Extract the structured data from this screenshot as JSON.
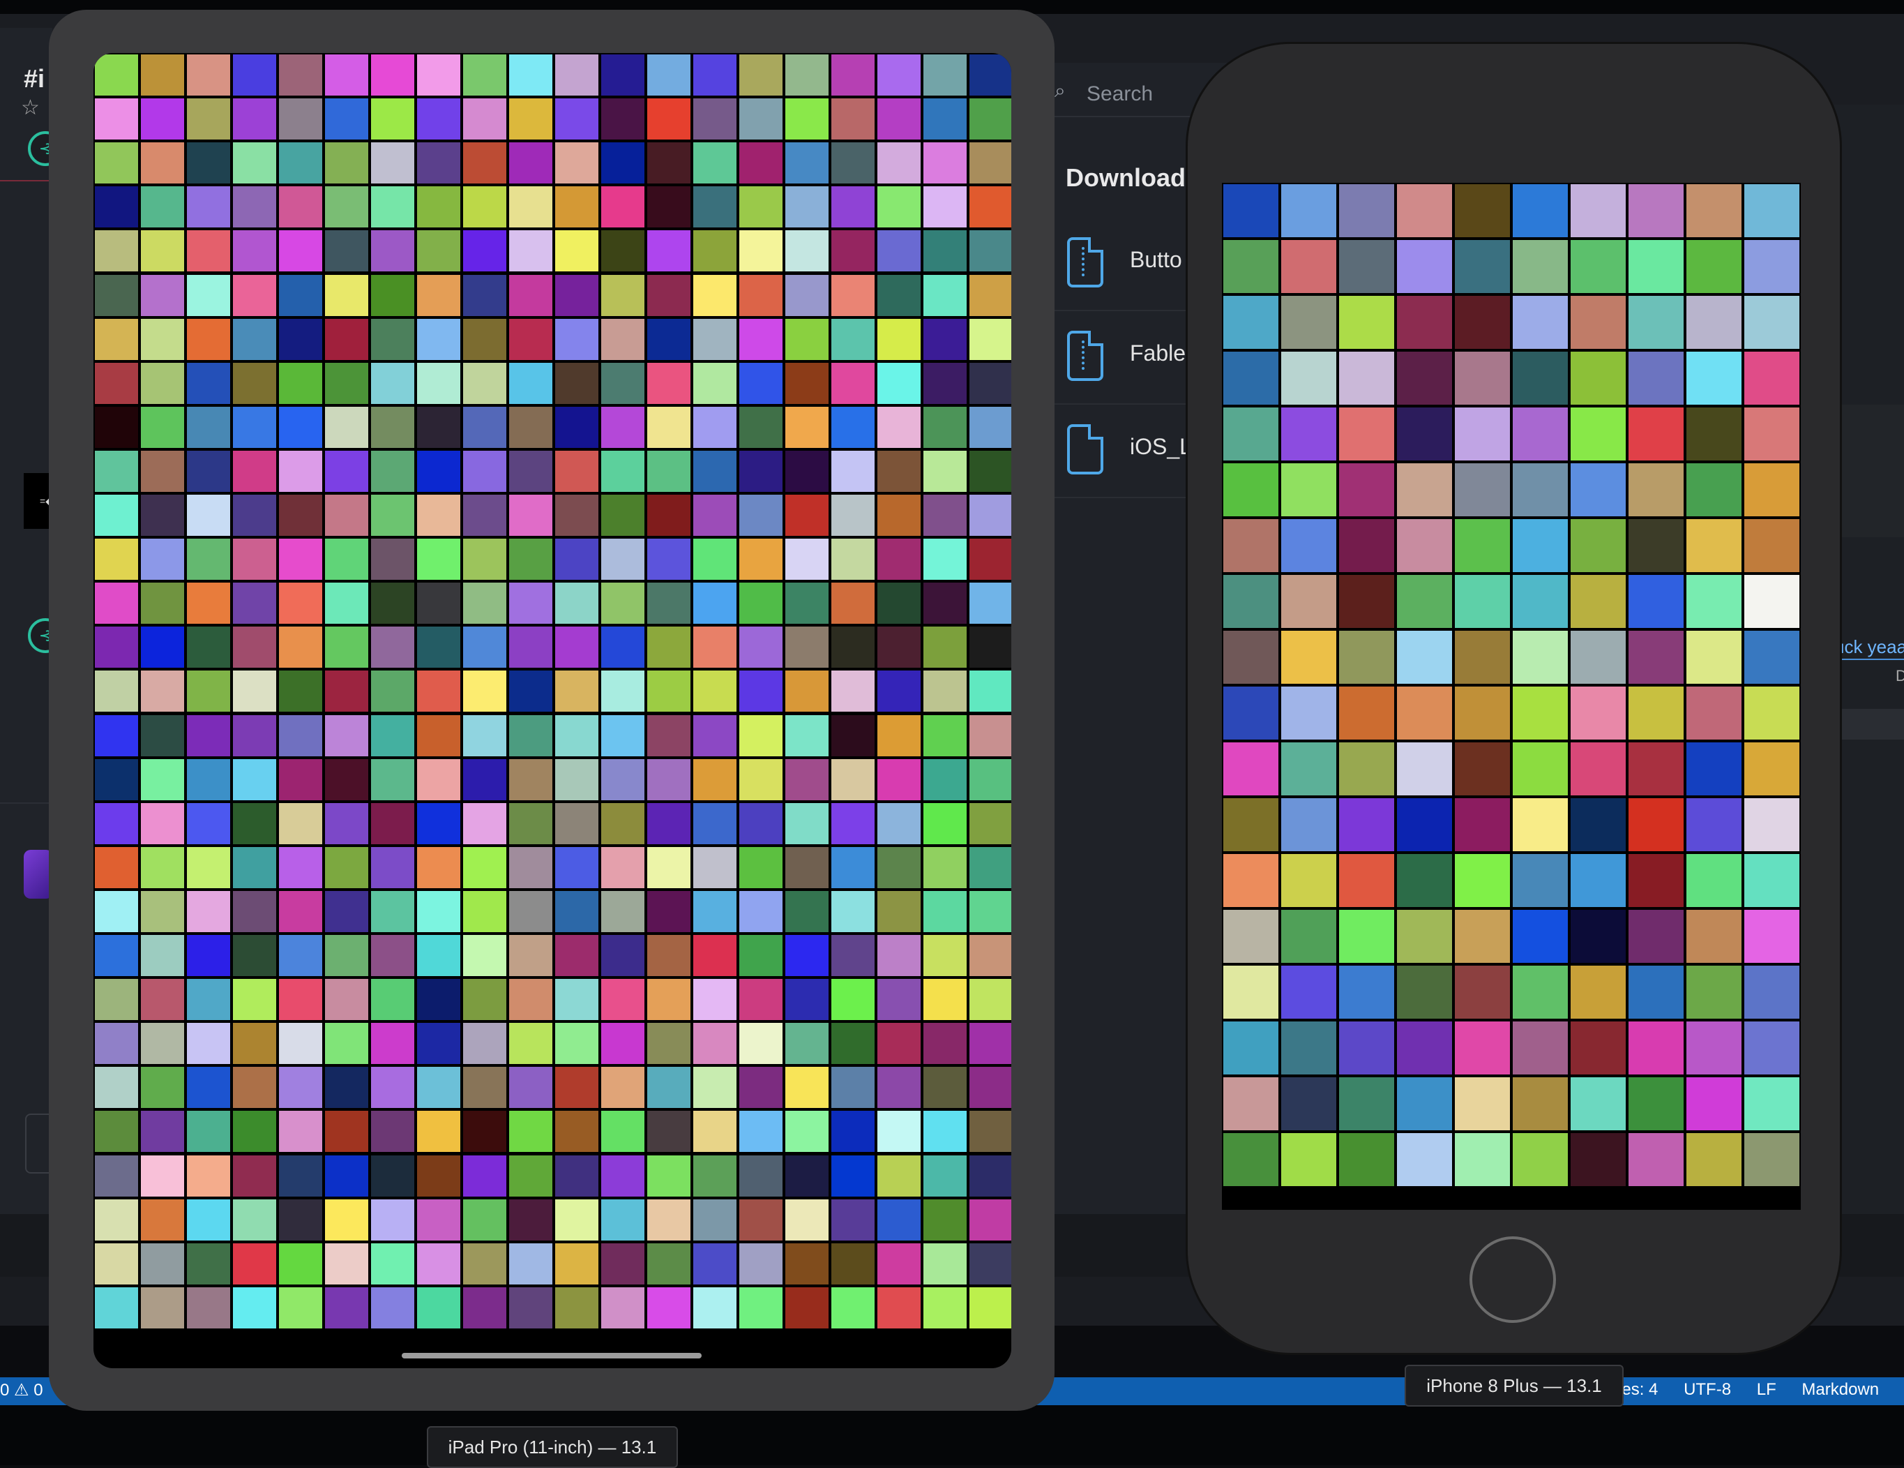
{
  "app": {
    "channel_title": "#i",
    "search_placeholder": "Search",
    "downloads_title": "Downloads",
    "files": [
      {
        "name": "Butto",
        "icon": "zip-file-icon"
      },
      {
        "name": "Fable",
        "icon": "zip-file-icon"
      },
      {
        "name": "iOS_L",
        "icon": "document-icon"
      }
    ],
    "right_partial_text": "uck yeaa",
    "right_partial_text_2": "D"
  },
  "status_bar": {
    "left": "0 ⚠ 0",
    "spaces": "aces: 4",
    "encoding": "UTF-8",
    "eol": "LF",
    "language": "Markdown"
  },
  "simulators": {
    "ipad": {
      "label": "iPad Pro (11-inch) — 13.1",
      "cols": 20,
      "rows": 29,
      "colors": [
        "#8ad84f",
        "#bc9238",
        "#d89384",
        "#4a3ee0",
        "#9c6478",
        "#d45de6",
        "#e64ad6",
        "#f29be9",
        "#7ac86c",
        "#7ee9f5",
        "#c4a4d0",
        "#251c93",
        "#73ace0",
        "#5543e0",
        "#a9a85d",
        "#93b88d",
        "#b640b3",
        "#a96aee",
        "#73a4a8",
        "#163289",
        "#ec8fe6",
        "#b239e9",
        "#a7a65c",
        "#9c41d6",
        "#8c808d",
        "#3069d9",
        "#9ce847",
        "#7141e9",
        "#d58ad0",
        "#dcb83c",
        "#7a4ae8",
        "#4a1446",
        "#e6402e",
        "#765a8a",
        "#81a1ae",
        "#8ae84a",
        "#b86868",
        "#b43ec4",
        "#3076bb",
        "#50a04a",
        "#91c65a",
        "#d88a6c",
        "#1f4250",
        "#8ae0a4",
        "#48a4a1",
        "#84b054",
        "#c0bfd0",
        "#5b408c",
        "#bc4c34",
        "#9f2ab8",
        "#dea89a",
        "#06209a",
        "#481c24",
        "#5ec896",
        "#a0226e",
        "#4789c4",
        "#4a6368",
        "#d3abdd",
        "#db7ddf",
        "#a88d5c",
        "#111680",
        "#56b78d",
        "#9170e0",
        "#8d67b4",
        "#d05896",
        "#7abd74",
        "#76e5a8",
        "#86b840",
        "#bcd848",
        "#e7e090",
        "#d49935",
        "#e63a8c",
        "#380c1c",
        "#3a707c",
        "#9ac94a",
        "#8ab0d8",
        "#8f43d5",
        "#88e870",
        "#dcb6f4",
        "#e05a2e",
        "#b8bc7e",
        "#ccda62",
        "#e4606c",
        "#b156d0",
        "#d748e4",
        "#3f5660",
        "#9c59c6",
        "#82b04a",
        "#6624e8",
        "#d8c0ee",
        "#f0f060",
        "#3c4416",
        "#ae45ee",
        "#8ca43a",
        "#f4f49a",
        "#c4e6e1",
        "#952560",
        "#6a6ad2",
        "#338078",
        "#4a888a",
        "#4a6650",
        "#b471cc",
        "#9bf4e0",
        "#ea6498",
        "#2460ac",
        "#e8e86a",
        "#4a9024",
        "#e49e56",
        "#333c8c",
        "#c43a9e",
        "#76229c",
        "#b8c058",
        "#8c2a50",
        "#fce86c",
        "#dc6448",
        "#9898cc",
        "#ea8474",
        "#2e6a5c",
        "#6ae6c4",
        "#cea046",
        "#d4b454",
        "#c4dc8c",
        "#e46c34",
        "#4a8cb8",
        "#141c80",
        "#a0203c",
        "#4c805c",
        "#80b8f0",
        "#7c6c30",
        "#b82c50",
        "#8484ec",
        "#c89c94",
        "#0c2a94",
        "#a0b4c0",
        "#ce4ae8",
        "#8ad040",
        "#5cc4ac",
        "#d6ec4a",
        "#3b1c96",
        "#d6f48c",
        "#a83c44",
        "#a6c474",
        "#2450b8",
        "#7c7030",
        "#5ab838",
        "#4c9438",
        "#82d0d8",
        "#b0ecd4",
        "#c0d49c",
        "#58c4e8",
        "#503a2c",
        "#4c7c70",
        "#ea5480",
        "#b0e8a0",
        "#3054e8",
        "#8c3c18",
        "#e0489e",
        "#6af4e8",
        "#3c1c64",
        "#30304c",
        "#200408",
        "#5ec45c",
        "#4888b4",
        "#3878e4",
        "#2864f0",
        "#ccd8bc",
        "#748c60",
        "#2c2434",
        "#5468b8",
        "#846c54",
        "#141490",
        "#b448d8",
        "#f0e490",
        "#a09cf0",
        "#407048",
        "#f0a84c",
        "#2870e8",
        "#e8b4d8",
        "#4c9458",
        "#6c9cd0",
        "#60c49c",
        "#9c6c58",
        "#2c3888",
        "#d03c88",
        "#dc9ce8",
        "#7c40e4",
        "#5ca874",
        "#0c28d0",
        "#8868e0",
        "#5c4480",
        "#d05854",
        "#5cd09c",
        "#5cc084",
        "#2c68b0",
        "#2c1c84",
        "#2c0c44",
        "#c4c4f4",
        "#7c5438",
        "#b8e898",
        "#2c5424",
        "#6ef0d0",
        "#3e3050",
        "#c8dcf4",
        "#4c3c8c",
        "#703038",
        "#c47888",
        "#6cc470",
        "#e8b898",
        "#6c4c8c",
        "#e06cc8",
        "#7c4c50",
        "#4c802c",
        "#801c1c",
        "#9c4cb8",
        "#6c88c4",
        "#c03028",
        "#b8c4c8",
        "#b8682c",
        "#80508c",
        "#a09ce0",
        "#e0d450",
        "#8c98e8",
        "#64b870",
        "#cc6090",
        "#e64ccc",
        "#60d478",
        "#6c5468",
        "#70f06c",
        "#9cc45c",
        "#58a044",
        "#4c44c4",
        "#acbcdc",
        "#5c54dc",
        "#60e478",
        "#e8a440",
        "#d8d4f4",
        "#c4d8a0",
        "#a02c70",
        "#74f4d8",
        "#9c2430",
        "#e04cc8",
        "#709440",
        "#e87c3c",
        "#7044a8",
        "#f06c58",
        "#6ce8b8",
        "#2c4424",
        "#38383c",
        "#90bc84",
        "#a070e0",
        "#8cd4c8",
        "#90c468",
        "#4c7868",
        "#4ca4f0",
        "#50bc48",
        "#3c8464",
        "#d06c3c",
        "#244830",
        "#3c1438",
        "#70b4e8",
        "#7c28b0",
        "#0c24dc",
        "#2c5c3c",
        "#a04c6c",
        "#e8904c",
        "#64c860",
        "#90689c",
        "#245c64",
        "#5088d8",
        "#8c40c4",
        "#a43cd0",
        "#2448d8",
        "#8ca83c",
        "#e88068",
        "#9c68d8",
        "#8c7c6c",
        "#2c2c20",
        "#4c2030",
        "#7ca03c",
        "#1c1c1c",
        "#c0d0a4",
        "#d8aaa4",
        "#80b448",
        "#dce0c4",
        "#3c7028",
        "#9c2440",
        "#5ca868",
        "#e05c4c",
        "#fcec70",
        "#0c2c8c",
        "#d8b460",
        "#a8ece0",
        "#9ccc44",
        "#c8dc50",
        "#5c38e4",
        "#d89838",
        "#e0bcd8",
        "#3424b8",
        "#bcc490",
        "#60e8c0",
        "#3034f0",
        "#2c4c44",
        "#7c2cb8",
        "#7c3cb4",
        "#7070c0",
        "#bc84d8",
        "#44b0a0",
        "#c8602c",
        "#90d4e0",
        "#4c9c80",
        "#88d8d0",
        "#6cc4f0",
        "#8c4464",
        "#8c48c4",
        "#d4f060",
        "#7ce4c8",
        "#2c0c1c",
        "#dc9c34",
        "#60d050",
        "#c89090",
        "#0c306c",
        "#78f0a0",
        "#3c90c8",
        "#68d0f0",
        "#9c2470",
        "#4c1028",
        "#5cb88c",
        "#eca4a4",
        "#2c1cac",
        "#a08460",
        "#a8c8b8",
        "#8888cc",
        "#a070c0",
        "#dc9c38",
        "#d8e060",
        "#a04c8c",
        "#d8c8a0",
        "#d83cb0",
        "#3ca890",
        "#58c080",
        "#6c3cec",
        "#ec90d0",
        "#4c58f0",
        "#2c5c2c",
        "#d8cc98",
        "#7c48c8",
        "#7c1c4c",
        "#1030dc",
        "#e4a4e4",
        "#6c8c48",
        "#8c8478",
        "#8c8c3c",
        "#5c24b4",
        "#3c68cc",
        "#4c40c0",
        "#80dcc8",
        "#7c40e8",
        "#8cb4dc",
        "#60e84c",
        "#80a040",
        "#e06030",
        "#a0e060",
        "#c4f070",
        "#40a0a0",
        "#b860e8",
        "#7ca840",
        "#7c4cc8",
        "#ec8c50",
        "#a0f050",
        "#a08c9c",
        "#4c5ce4",
        "#e4a0ac",
        "#ecf4a8",
        "#c0c0cc",
        "#5cc040",
        "#706050",
        "#3c8cd8",
        "#5c844c",
        "#90d060",
        "#40a080",
        "#a0f0f4",
        "#a8c07c",
        "#e4a8e0",
        "#6c4c74",
        "#c83ca0",
        "#403090",
        "#5cc4a0",
        "#7cf4e0",
        "#a0e84c",
        "#8c8c8c",
        "#2c68a8",
        "#9ca898",
        "#5c1454",
        "#58b0e0",
        "#90a4f0",
        "#347450",
        "#8ce0e0",
        "#8c9444",
        "#5cd8a0",
        "#60d490",
        "#2c70dc",
        "#9cccc0",
        "#2c20e8",
        "#2c4c34",
        "#4c84dc",
        "#6cb070",
        "#8c5088",
        "#50d8d8",
        "#c4f8b0",
        "#c0a088",
        "#9c2c6c",
        "#3c2c8c",
        "#a46444",
        "#dc3050",
        "#40a44c",
        "#2c28f0",
        "#60448c",
        "#bc80c8",
        "#c8e060",
        "#c89478",
        "#9cb47c",
        "#b8586c",
        "#50a8c8",
        "#b0ec5c",
        "#e84c6c",
        "#c88ca0",
        "#58cc74",
        "#0c1c6c",
        "#7c9c40",
        "#d08c6c",
        "#8cd8d4",
        "#e8508c",
        "#e4a058",
        "#e4b8f4",
        "#cc3c80",
        "#2c2cb0",
        "#6cf04c",
        "#8850b0",
        "#f4e04c",
        "#c0e460",
        "#9080c8",
        "#b0b8a4",
        "#c8c4f4",
        "#ac8430",
        "#d8dce8",
        "#80e478",
        "#cc3ccc",
        "#1c28a4",
        "#aca4bc",
        "#b8e45c",
        "#90ec90",
        "#c838d0",
        "#888c58",
        "#d888c0",
        "#ecf4cc",
        "#64b490",
        "#306c2c",
        "#a82c58",
        "#882868",
        "#a030a8",
        "#b0d0c8",
        "#60ac4c",
        "#1c54d0",
        "#ac7048",
        "#a080e0",
        "#142860",
        "#a86ce0",
        "#6cc0d8",
        "#887458",
        "#8c60c4",
        "#b03c2c",
        "#e0a478",
        "#58acbc",
        "#c8ecb0",
        "#7c2c80",
        "#f8e458",
        "#5c80a8",
        "#8c48a8",
        "#5c5c3c",
        "#8c2c88",
        "#5c8c3c",
        "#703ca0",
        "#4cb090",
        "#3c8c2c",
        "#d890cc",
        "#a03420",
        "#6c3874",
        "#f0c040",
        "#3c0c0c",
        "#70d844",
        "#985c24",
        "#64e064",
        "#483c40",
        "#e8d488",
        "#6cbcf4",
        "#8cf4a0",
        "#0c2cbc",
        "#c4f8f4",
        "#60e0f0",
        "#706040",
        "#6c6c8c",
        "#f8c0d8",
        "#f4ac8c",
        "#902c50",
        "#243c6c",
        "#0c30c8",
        "#1c2c3c",
        "#7c3c18",
        "#7c2cd8",
        "#60a838",
        "#403080",
        "#8c3cd8",
        "#7ce060",
        "#5ca058",
        "#506070",
        "#1c1c44",
        "#0438d0",
        "#b8d054",
        "#4cb8a8",
        "#2c2c68",
        "#d8e0b0",
        "#d8783c",
        "#5cd8f0",
        "#90dcb0",
        "#302c3c",
        "#fce85c",
        "#b8b0f4",
        "#c860c4",
        "#64c060",
        "#4c1c3c",
        "#e0f4a0",
        "#5cc0d8",
        "#e8c8a4",
        "#7c98a8",
        "#a05048",
        "#ece8b8",
        "#583c98",
        "#2c5cd0",
        "#508c2c",
        "#c03ca4",
        "#d8d8a4",
        "#909ca0",
        "#407048",
        "#e03848",
        "#64d840",
        "#ecccc8",
        "#70f0b0",
        "#d890e4",
        "#9c985c",
        "#a0b8e4",
        "#dcb444",
        "#702c5c",
        "#5c8c48",
        "#4c4cc8",
        "#a0a0c4",
        "#804c1c",
        "#5c4c1c",
        "#ce3ca0",
        "#a8e898",
        "#3c3c60",
        "#60d4d8",
        "#ac9c88",
        "#987888",
        "#64ecf0",
        "#90e868",
        "#7838b0",
        "#8480e0",
        "#4cd8a0",
        "#7c2c8c",
        "#60447c",
        "#8c9440",
        "#d090c8",
        "#d84ce8",
        "#acf0f0",
        "#70f080",
        "#982c1c",
        "#70f070",
        "#e04c50",
        "#a8f060",
        "#bcf04c"
      ]
    },
    "iphone": {
      "label": "iPhone 8 Plus — 13.1",
      "cols": 10,
      "rows": 18,
      "colors": [
        "#1a48b8",
        "#6a9ee0",
        "#7c7cb0",
        "#d08a8a",
        "#5a4818",
        "#2c7ad8",
        "#c4b0dc",
        "#b878c0",
        "#c4906c",
        "#70b8d8",
        "#58a058",
        "#d06c70",
        "#5c6c78",
        "#9c8cec",
        "#3a7080",
        "#88b888",
        "#5cc06c",
        "#6ae8a0",
        "#5cb840",
        "#8c9ce0",
        "#4ea8c8",
        "#8c9480",
        "#acdc48",
        "#8c2c50",
        "#5c1c24",
        "#9cace8",
        "#c07c68",
        "#6cc0b8",
        "#b8b4cc",
        "#9ccad8",
        "#2c6ca8",
        "#b8d4d0",
        "#cab8d8",
        "#5c2048",
        "#a8788c",
        "#2c5c60",
        "#8cc038",
        "#6c74c0",
        "#70e0f4",
        "#e04c88",
        "#58a890",
        "#8c4ce0",
        "#e07070",
        "#2c1c5c",
        "#c0a4e4",
        "#a868d0",
        "#88e848",
        "#e04048",
        "#48481c",
        "#d87878",
        "#58c040",
        "#90e060",
        "#a03074",
        "#c8a490",
        "#808898",
        "#7090a8",
        "#5c8ee0",
        "#b89c68",
        "#48a050",
        "#d89c38",
        "#b07468",
        "#5c84e0",
        "#741c4c",
        "#c88ca0",
        "#5cc04c",
        "#4cb0e0",
        "#78b040",
        "#3c3c28",
        "#e0bc4c",
        "#c07c3c",
        "#4c9080",
        "#c49c88",
        "#5c201c",
        "#5cb060",
        "#5ed0a8",
        "#50b8c8",
        "#b8b040",
        "#3060e0",
        "#78ecb0",
        "#f4f4f0",
        "#705858",
        "#ecc048",
        "#90985c",
        "#9cd4f0",
        "#987c38",
        "#b8ecb0",
        "#9cacb0",
        "#883c78",
        "#dce888",
        "#3878c0",
        "#2c48b8",
        "#a0b4e8",
        "#cc6c30",
        "#dc8c58",
        "#c09038",
        "#a8e040",
        "#e888a8",
        "#c8c040",
        "#c06878",
        "#c8dc54",
        "#e048c0",
        "#5cb098",
        "#98a850",
        "#d0d0e8",
        "#6c3020",
        "#8cdc40",
        "#d84878",
        "#a83040",
        "#1440c0",
        "#d8a838",
        "#7c7028",
        "#6c94d8",
        "#7c38d8",
        "#0c24b0",
        "#8c1c60",
        "#f8ec88",
        "#0c2c5c",
        "#d43020",
        "#5c4cd8",
        "#e0d4e4",
        "#ec8c5c",
        "#ccd04c",
        "#e05840",
        "#2c6c48",
        "#80f048",
        "#4888b8",
        "#4098d8",
        "#881c24",
        "#60e080",
        "#64e0c0",
        "#b8b4a4",
        "#50a058",
        "#70ec60",
        "#a0b858",
        "#c8a058",
        "#1450e0",
        "#0c0c38",
        "#702c6c",
        "#c08858",
        "#e464e4",
        "#e0e8a0",
        "#5c4ce0",
        "#3c7cd0",
        "#4c6c3c",
        "#8c4040",
        "#60c068",
        "#c8a038",
        "#2c70bc",
        "#6ca848",
        "#5c74c8",
        "#40a0c0",
        "#3c7888",
        "#5c48c8",
        "#7030b0",
        "#e048a8",
        "#a0608c",
        "#882830",
        "#d83cb0",
        "#b858c8",
        "#6c74d0",
        "#c89898",
        "#2c3858",
        "#3c8468",
        "#3c90c8",
        "#e8d49c",
        "#a88c40",
        "#6cd8c0",
        "#3c903c",
        "#d03cd8",
        "#70e8c0",
        "#48903c",
        "#a0dc48",
        "#489030",
        "#b0ccf0",
        "#a0eeb0",
        "#90d048",
        "#3c1420",
        "#c060b0",
        "#b8b040",
        "#8c9870"
      ]
    }
  }
}
